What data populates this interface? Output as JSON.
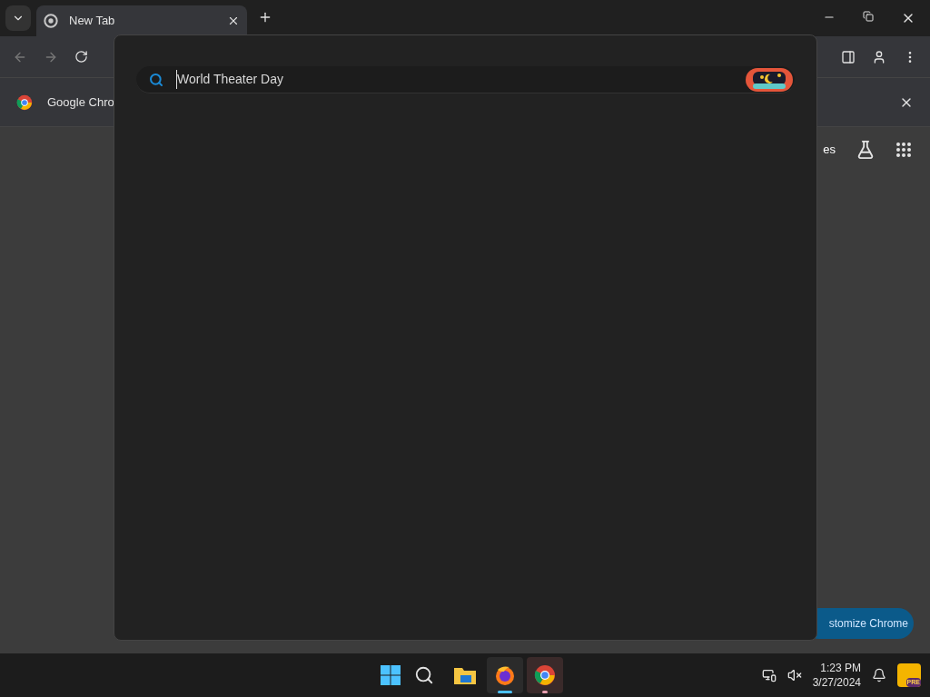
{
  "tab_strip": {
    "tabs": [
      {
        "title": "New Tab",
        "selected": true
      }
    ]
  },
  "info_bar": {
    "text": "Google Chro"
  },
  "new_tab_page": {
    "partial_link": "es",
    "customize_button": "stomize Chrome"
  },
  "omnibox_popup": {
    "query": "World Theater Day"
  },
  "taskbar": {
    "apps": [
      {
        "kind": "files",
        "running": false,
        "selected": false
      },
      {
        "kind": "firefox",
        "running": true,
        "selected": false
      },
      {
        "kind": "chrome",
        "running": true,
        "selected": true
      }
    ],
    "time": "1:23 PM",
    "date": "3/27/2024",
    "badge": "PRE"
  }
}
